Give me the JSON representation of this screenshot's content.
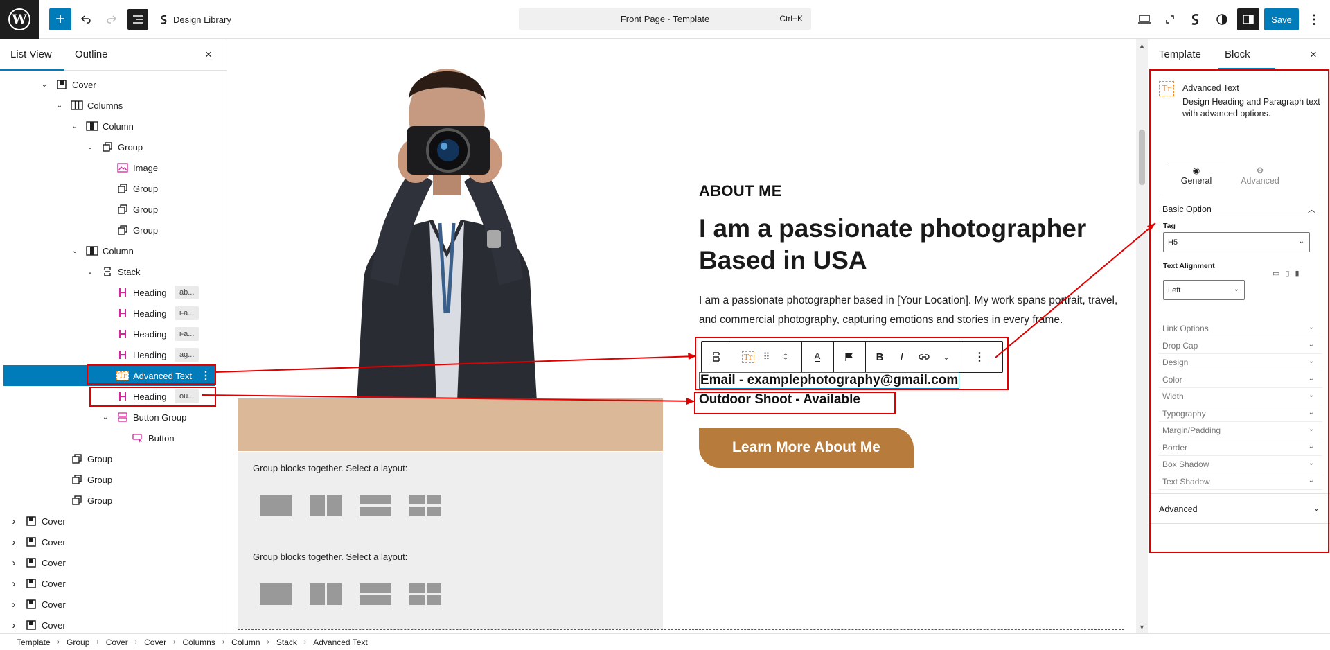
{
  "topbar": {
    "logo": "W",
    "add_icon": "plus-icon",
    "design_library": "Design Library",
    "document_title": "Front Page · Template",
    "shortcut": "Ctrl+K",
    "save": "Save"
  },
  "list_view": {
    "tabs": [
      "List View",
      "Outline"
    ],
    "close": "×",
    "items": [
      {
        "label": "Cover",
        "icon": "cover-icon",
        "expanded": true
      },
      {
        "label": "Columns",
        "icon": "columns-icon",
        "expanded": true
      },
      {
        "label": "Column",
        "icon": "column-icon",
        "expanded": true
      },
      {
        "label": "Group",
        "icon": "group-icon",
        "expanded": true
      },
      {
        "label": "Image",
        "icon": "image-icon"
      },
      {
        "label": "Group",
        "icon": "group-icon"
      },
      {
        "label": "Group",
        "icon": "group-icon"
      },
      {
        "label": "Group",
        "icon": "group-icon"
      },
      {
        "label": "Column",
        "icon": "column-icon",
        "expanded": true
      },
      {
        "label": "Stack",
        "icon": "stack-icon",
        "expanded": true
      },
      {
        "label": "Heading",
        "icon": "heading-icon",
        "chip": "ab..."
      },
      {
        "label": "Heading",
        "icon": "heading-icon",
        "chip": "i-a..."
      },
      {
        "label": "Heading",
        "icon": "heading-icon",
        "chip": "i-a..."
      },
      {
        "label": "Heading",
        "icon": "heading-icon",
        "chip": "ag..."
      },
      {
        "label": "Advanced Text",
        "icon": "advanced-text-icon",
        "selected": true
      },
      {
        "label": "Heading",
        "icon": "heading-icon",
        "chip": "ou..."
      },
      {
        "label": "Button Group",
        "icon": "button-group-icon",
        "expanded": true
      },
      {
        "label": "Button",
        "icon": "button-icon"
      },
      {
        "label": "Group",
        "icon": "group-icon"
      },
      {
        "label": "Group",
        "icon": "group-icon"
      },
      {
        "label": "Group",
        "icon": "group-icon"
      },
      {
        "label": "Cover",
        "icon": "cover-icon",
        "expanded": false
      },
      {
        "label": "Cover",
        "icon": "cover-icon",
        "expanded": false
      },
      {
        "label": "Cover",
        "icon": "cover-icon",
        "expanded": false
      },
      {
        "label": "Cover",
        "icon": "cover-icon",
        "expanded": false
      },
      {
        "label": "Cover",
        "icon": "cover-icon",
        "expanded": false
      },
      {
        "label": "Cover",
        "icon": "cover-icon",
        "expanded": false
      }
    ]
  },
  "canvas": {
    "kicker": "ABOUT ME",
    "headline": "I am a passionate photographer Based in USA",
    "paragraph": "I am a passionate photographer based in [Your Location]. My work spans portrait, travel, and commercial photography, capturing emotions and stories in every frame.",
    "email": "Email - examplephotography@gmail.com",
    "outdoor": "Outdoor Shoot - Available",
    "cta": "Learn More About Me",
    "placeholder_text": "Group blocks together. Select a layout:"
  },
  "inspector": {
    "tabs": [
      "Template",
      "Block"
    ],
    "close": "×",
    "block_title": "Advanced Text",
    "block_desc": "Design Heading and Paragraph text with advanced options.",
    "sub_tabs": [
      "General",
      "Advanced"
    ],
    "basic_option": "Basic Option",
    "tag_label": "Tag",
    "tag_value": "H5",
    "align_label": "Text Alignment",
    "align_value": "Left",
    "accordions": [
      "Link Options",
      "Drop Cap",
      "Design",
      "Color",
      "Width",
      "Typography",
      "Margin/Padding",
      "Border",
      "Box Shadow",
      "Text Shadow"
    ],
    "advanced": "Advanced"
  },
  "breadcrumb": [
    "Template",
    "Group",
    "Cover",
    "Cover",
    "Columns",
    "Column",
    "Stack",
    "Advanced Text"
  ],
  "colors": {
    "accent": "#007cba",
    "cta": "#b77c3c",
    "annotation": "#e00000",
    "icon_heading": "#d6249f",
    "icon_advtext": "#f08c28"
  }
}
